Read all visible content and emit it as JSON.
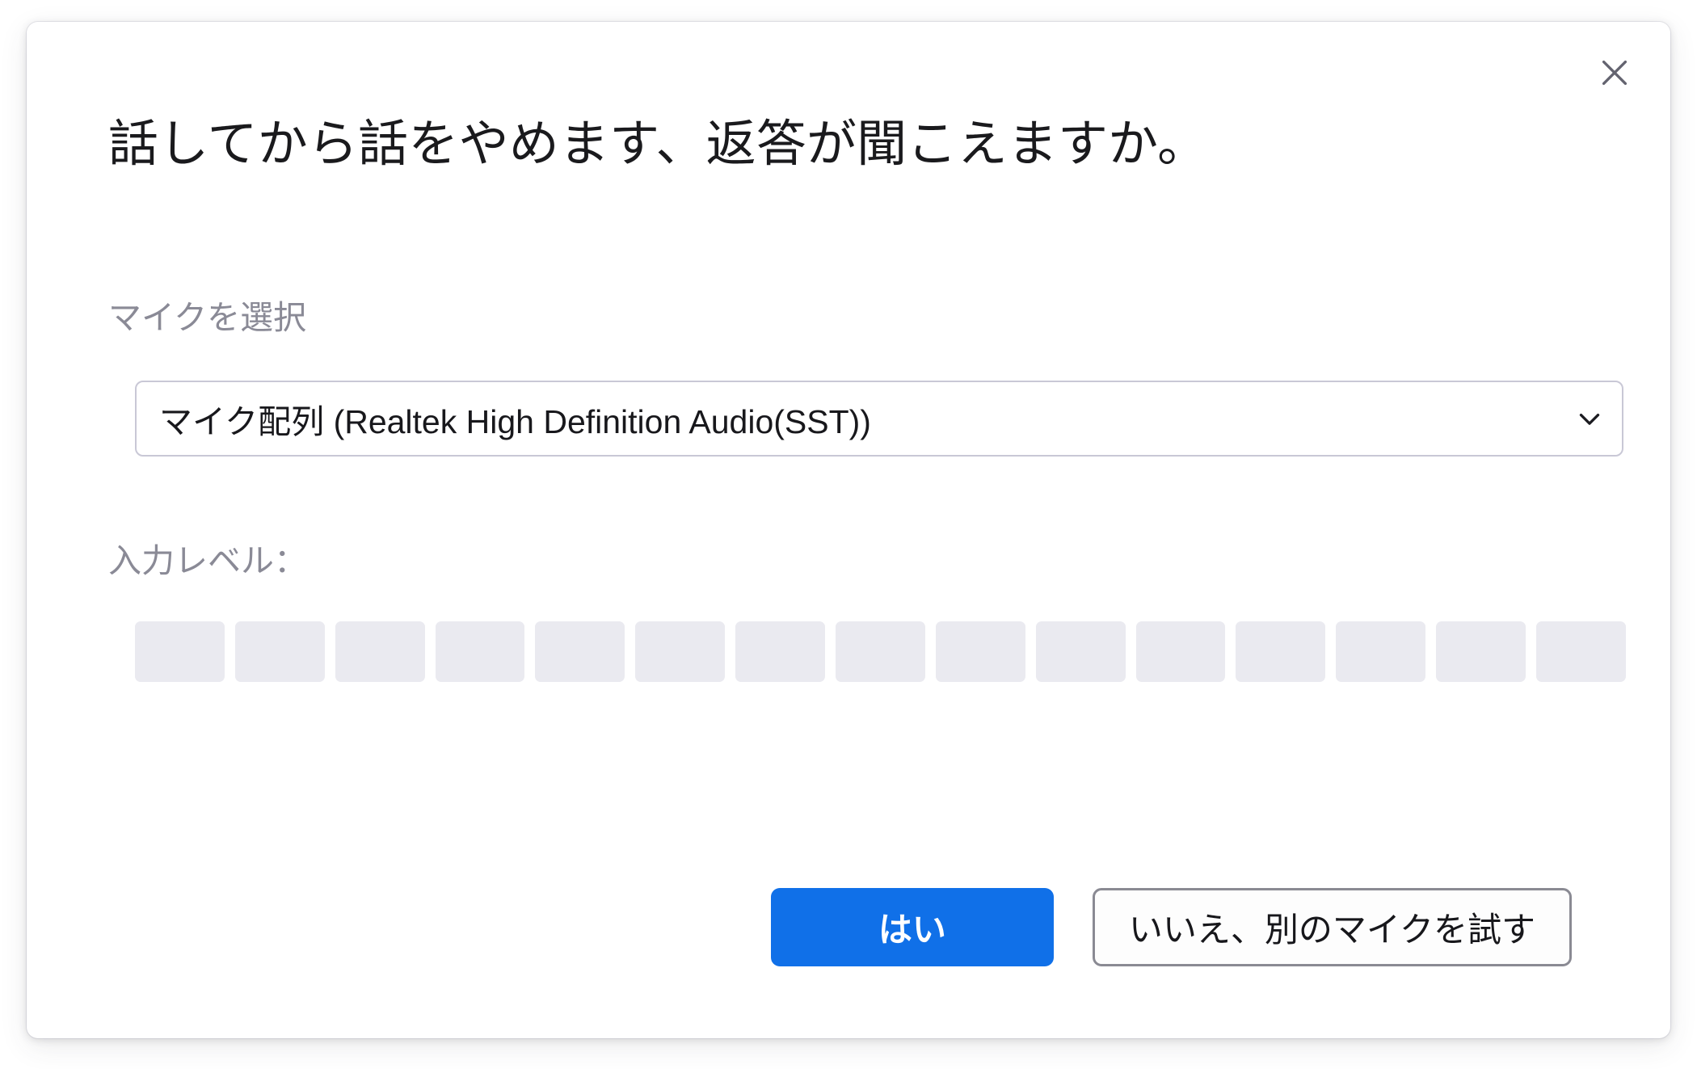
{
  "dialog": {
    "title": "話してから話をやめます、返答が聞こえますか。",
    "close_icon": "close-icon",
    "close_label": "閉じる"
  },
  "mic_field": {
    "label": "マイクを選択",
    "selected_value": "マイク配列 (Realtek High Definition Audio(SST))",
    "chevron_icon": "chevron-down-icon"
  },
  "input_level": {
    "label": "入力レベル：",
    "segment_count": 15,
    "segments_active": 0,
    "segment_color_off": "#eaeaf0",
    "segment_color_on": "#1673e6"
  },
  "actions": {
    "primary_label": "はい",
    "secondary_label": "いいえ、別のマイクを試す",
    "primary_color": "#1070e8"
  }
}
